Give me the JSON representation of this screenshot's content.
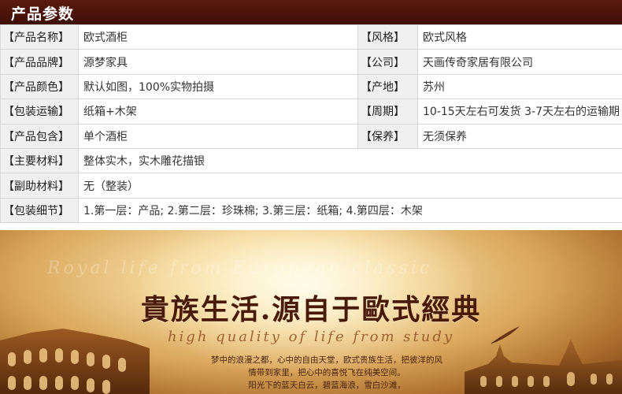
{
  "header": {
    "title": "产品参数"
  },
  "specs": [
    {
      "l1": "【产品名称】",
      "v1": "欧式酒柜",
      "l2": "【风格】",
      "v2": "欧式风格"
    },
    {
      "l1": "【产品品牌】",
      "v1": "源梦家具",
      "l2": "【公司】",
      "v2": "天画传奇家居有限公司"
    },
    {
      "l1": "【产品颜色】",
      "v1": "默认如图，100%实物拍摄",
      "l2": "【产地】",
      "v2": "苏州"
    },
    {
      "l1": "【包装运输】",
      "v1": "纸箱+木架",
      "l2": "【周期】",
      "v2": "10-15天左右可发货 3-7天左右的运输期"
    },
    {
      "l1": "【产品包含】",
      "v1": "单个酒柜",
      "l2": "【保养】",
      "v2": "无须保养"
    },
    {
      "l1": "【主要材料】",
      "v1": "整体实木，实木雕花描银"
    },
    {
      "l1": "【副助材料】",
      "v1": "无（整装）"
    },
    {
      "l1": "【包装细节】",
      "v1": "1.第一层：产品; 2.第二层：珍珠棉; 3.第三层：纸箱; 4.第四层：木架"
    }
  ],
  "banner": {
    "headline": "貴族生活.源自于歐式經典",
    "script": "high quality of life  from study",
    "ghost_script": "Royal life from European classic",
    "poem": [
      "梦中的浪漫之都，心中的自由天堂，欧式贵族生活，把彼洋的风",
      "情带到家里，把心中的喜悦飞在纯美空间。",
      "阳光下的蓝天白云，碧蓝海浪，雪白沙滩，"
    ]
  }
}
